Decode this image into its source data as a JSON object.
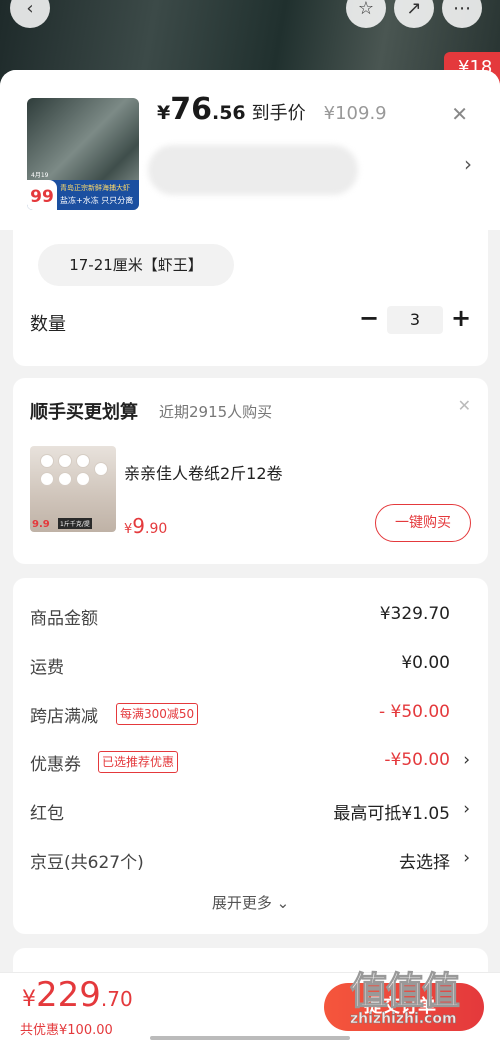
{
  "background": {
    "badge": "¥18"
  },
  "product": {
    "price_symbol": "¥",
    "price_int": "76",
    "price_dec": ".56",
    "price_label": "到手价",
    "original_price": "¥109.9",
    "thumb_price": "99",
    "thumb_top_text": "青岛正宗新鲜海捕大虾",
    "thumb_band_text": "盐冻+水冻 只只分离",
    "thumb_date": "4月19"
  },
  "spec": {
    "option": "17-21厘米【虾王】",
    "quantity_label": "数量",
    "quantity": "3"
  },
  "bundle": {
    "title": "顺手买更划算",
    "subtitle": "近期2915人购买",
    "item_name": "亲亲佳人卷纸2斤12卷",
    "price_symbol": "¥",
    "price_int": "9",
    "price_dec": ".90",
    "buy_label": "一键购买",
    "thumb_price": "9.9",
    "thumb_text": "1斤千克/提"
  },
  "summary": {
    "rows": [
      {
        "label": "商品金额",
        "value": "¥329.70"
      },
      {
        "label": "运费",
        "value": "¥0.00"
      },
      {
        "label": "跨店满减",
        "tag": "每满300减50",
        "value": "- ¥50.00"
      },
      {
        "label": "优惠券",
        "tag": "已选推荐优惠",
        "value": "-¥50.00"
      },
      {
        "label": "红包",
        "value": "最高可抵¥1.05"
      },
      {
        "label": "京豆(共627个)",
        "value": "去选择"
      }
    ],
    "more_label": "展开更多"
  },
  "footer": {
    "total_symbol": "¥",
    "total_int": "229",
    "total_dec": ".70",
    "discount_text": "共优惠¥100.00",
    "submit_label": "提交订单"
  },
  "watermark": {
    "big": "值值值",
    "url": "zhizhizhi.com"
  },
  "colors": {
    "accent": "#e4393c"
  }
}
